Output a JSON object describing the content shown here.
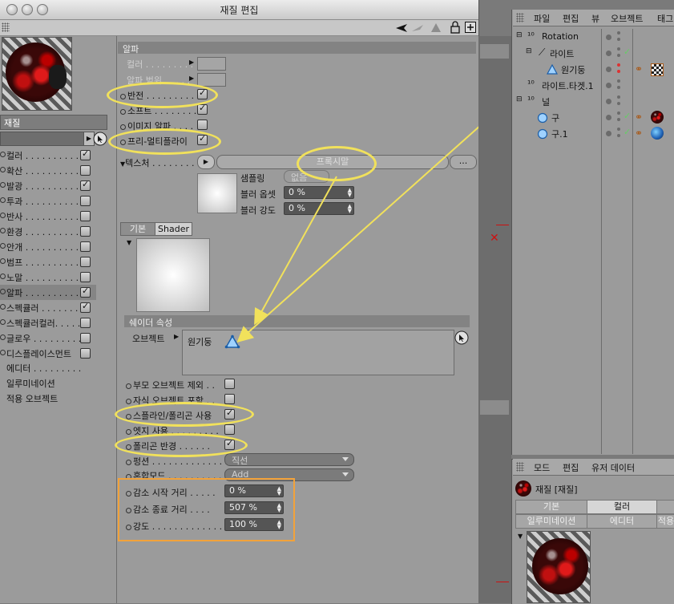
{
  "window": {
    "title": "재질 편집"
  },
  "left_panel": {
    "material_name": "재질",
    "channels": [
      {
        "label": "컬러 . . . . . . . . . . .",
        "checked": true
      },
      {
        "label": "확산 . . . . . . . . . . .",
        "checked": false
      },
      {
        "label": "발광 . . . . . . . . . . .",
        "checked": true
      },
      {
        "label": "투과 . . . . . . . . . . .",
        "checked": false
      },
      {
        "label": "반사 . . . . . . . . . . .",
        "checked": false
      },
      {
        "label": "환경 . . . . . . . . . . .",
        "checked": false
      },
      {
        "label": "안개 . . . . . . . . . . .",
        "checked": false
      },
      {
        "label": "범프 . . . . . . . . . . .",
        "checked": false
      },
      {
        "label": "노말 . . . . . . . . . . .",
        "checked": false
      },
      {
        "label": "알파 . . . . . . . . . . .",
        "checked": true
      },
      {
        "label": "스펙큘러 . . . . . . .",
        "checked": true
      },
      {
        "label": "스펙큘러컬러. . . . .",
        "checked": false
      },
      {
        "label": "글로우 . . . . . . . . .",
        "checked": false
      },
      {
        "label": "디스플레이스먼트",
        "checked": false
      }
    ],
    "extra_items": [
      "에디터 . . . . . . . . .",
      "일루미네이션",
      "적용 오브젝트"
    ]
  },
  "alpha_section": {
    "header": "알파",
    "color_label": "컬러 . . . . . . . . .",
    "alpha_range_label": "알파 범위 . . . . .",
    "invert_label": "반전 . . . . . . . . . .",
    "invert_checked": true,
    "soft_label": "소프트 . . . . . . . . .",
    "soft_checked": true,
    "image_alpha_label": "이미지 알파 . . . .",
    "image_alpha_checked": false,
    "premultiply_label": "프리-멀티플라이",
    "premultiply_checked": true,
    "texture_label": "텍스처 . . . . . . . . .",
    "texture_button": "프록시말",
    "more_button": "...",
    "sampling_label": "샘플링",
    "sampling_value": "없음",
    "blur_offset_label": "블러 옵셋",
    "blur_offset_value": "0 %",
    "blur_strength_label": "블러 강도",
    "blur_strength_value": "0 %"
  },
  "shader_tabs": [
    "기본",
    "Shader"
  ],
  "shader_props": {
    "header": "쉐이더 속성",
    "object_label": "오브젝트",
    "object_value": "원기둥",
    "exclude_parent_label": "부모 오브젝트 제외 . .",
    "exclude_parent_checked": false,
    "include_children_label": "자식 오브젝트 포함 . .",
    "include_children_checked": false,
    "spline_polygon_label": "스플라인/폴리곤 사용",
    "spline_polygon_checked": true,
    "use_edges_label": "엣지 사용 . . . . . . . . .",
    "use_edges_checked": false,
    "polygon_radius_label": "폴리곤 반경 . . . . . .",
    "polygon_radius_checked": true,
    "function_label": "펑션 . . . . . . . . . . . . . .",
    "function_value": "직선",
    "blend_label": "혼합모드 . . . . . . . . . .",
    "blend_value": "Add",
    "falloff_start_label": "감소 시작 거리 . . . . .",
    "falloff_start_value": "0 %",
    "falloff_end_label": "감소 종료 거리 . . . .",
    "falloff_end_value": "507 %",
    "strength_label": "강도 . . . . . . . . . . . . . .",
    "strength_value": "100 %"
  },
  "object_manager": {
    "menu": [
      "파일",
      "편집",
      "뷰",
      "오브젝트",
      "태그"
    ],
    "items": [
      {
        "name": "Rotation",
        "indent": 0
      },
      {
        "name": "라이트",
        "indent": 1
      },
      {
        "name": "원기둥",
        "indent": 2
      },
      {
        "name": "라이트.타겟.1",
        "indent": 0
      },
      {
        "name": "널",
        "indent": 0
      },
      {
        "name": "구",
        "indent": 1
      },
      {
        "name": "구.1",
        "indent": 1
      }
    ]
  },
  "attribute_manager": {
    "menu": [
      "모드",
      "편집",
      "유저 데이터"
    ],
    "title": "재질 [재질]",
    "tabs_row1": [
      "기본",
      "컬러",
      ""
    ],
    "tabs_row2": [
      "일루미네이션",
      "에디터",
      "적용"
    ]
  },
  "colors": {
    "highlight": "#f1e15b",
    "orange_box": "#f2a23a",
    "panel_bg": "#9b9b9b"
  }
}
